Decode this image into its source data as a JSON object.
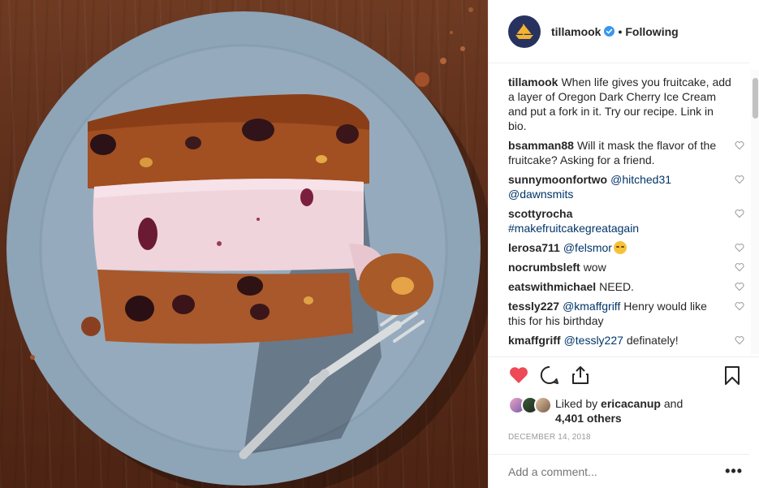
{
  "post": {
    "username": "tillamook",
    "separator": "•",
    "follow_status": "Following",
    "caption": {
      "user": "tillamook",
      "text": "When life gives you fruitcake, add a layer of Oregon Dark Cherry Ice Cream and put a fork in it. Try our recipe. Link in bio."
    },
    "comments": [
      {
        "user": "bsamman88",
        "text": "Will it mask the flavor of the fruitcake? Asking for a friend.",
        "mention": "",
        "after": ""
      },
      {
        "user": "sunnymoonfortwo",
        "text": "",
        "mention": "@hitched31 @dawnsmits",
        "after": ""
      },
      {
        "user": "scottyrocha",
        "text": "",
        "mention": "#makefruitcakegreatagain",
        "after": ""
      },
      {
        "user": "lerosa711",
        "text": "",
        "mention": "@felsmor",
        "after": ""
      },
      {
        "user": "nocrumbsleft",
        "text": "wow",
        "mention": "",
        "after": ""
      },
      {
        "user": "eatswithmichael",
        "text": "NEED.",
        "mention": "",
        "after": ""
      },
      {
        "user": "tessly227",
        "text": "",
        "mention": "@kmaffgriff",
        "after": "Henry would like this for his birthday"
      },
      {
        "user": "kmaffgriff",
        "text": "",
        "mention": "@tessly227",
        "after": "definately!"
      }
    ],
    "liked_by_prefix": "Liked by",
    "liked_by_user": "ericacanup",
    "liked_by_and": "and",
    "others": "4,401 others",
    "date": "DECEMBER 14, 2018",
    "comment_placeholder": "Add a comment...",
    "more_label": "•••",
    "icons": [
      "heart-filled-icon",
      "comment-icon",
      "share-icon",
      "bookmark-icon",
      "verified-icon",
      "ellipsis-icon"
    ],
    "colors": {
      "like": "#ed4956",
      "mention": "#003569",
      "verified": "#3897f0",
      "muted": "#999999"
    }
  }
}
